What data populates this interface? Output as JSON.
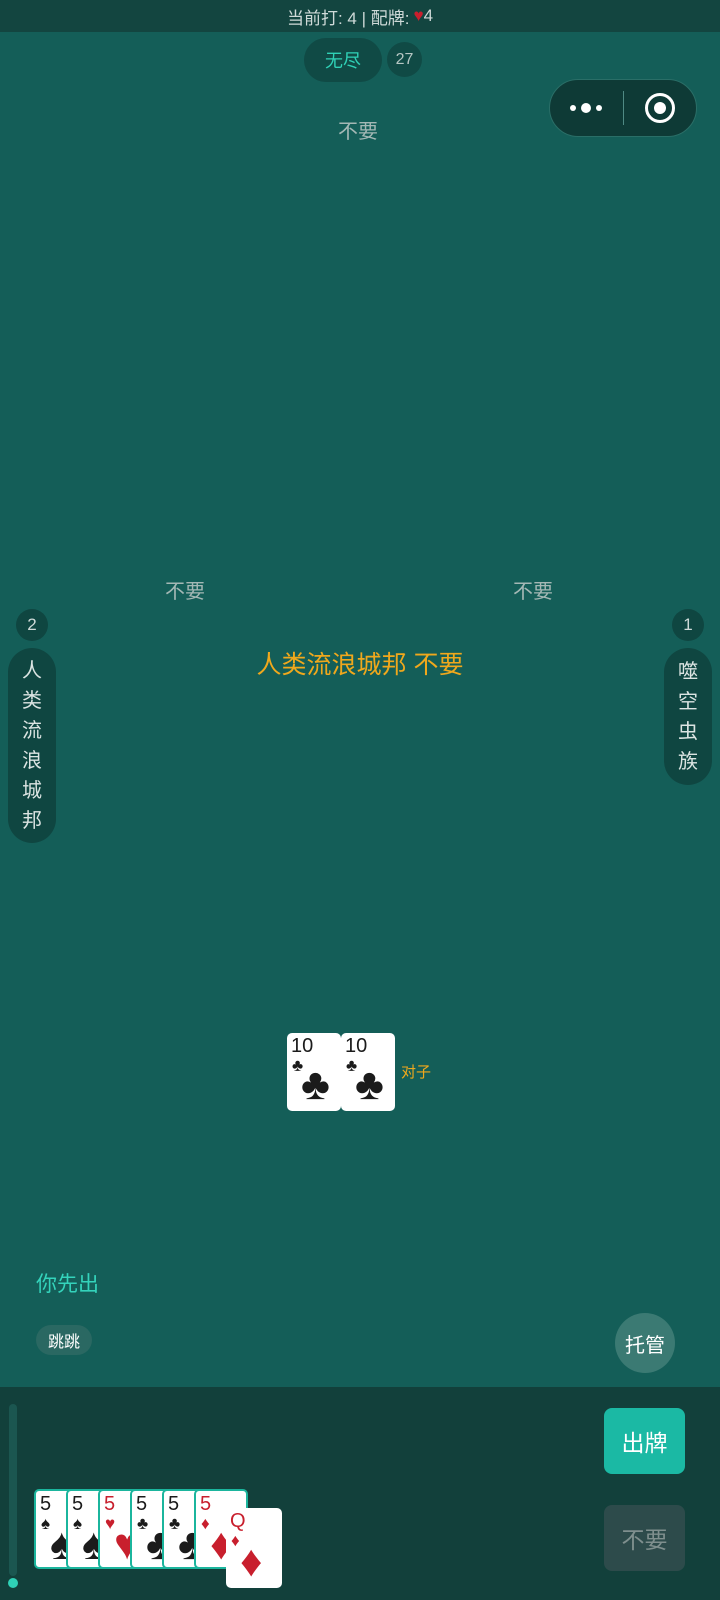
{
  "status_bar": {
    "prefix": "当前打: 4 | 配牌: ",
    "heart": "♥",
    "wild_rank": "4"
  },
  "mode": {
    "label": "无尽",
    "count": "27"
  },
  "capsule": {
    "more_icon": "more-dots-icon",
    "close_icon": "target-icon"
  },
  "opponents": {
    "top": {
      "action": "不要"
    },
    "left": {
      "rank": "2",
      "name_chars": [
        "人",
        "类",
        "流",
        "浪",
        "城",
        "邦"
      ],
      "action": "不要"
    },
    "right": {
      "rank": "1",
      "name_chars": [
        "噬",
        "空",
        "虫",
        "族"
      ],
      "action": "不要"
    }
  },
  "center_message": "人类流浪城邦 不要",
  "last_play": {
    "cards": [
      {
        "rank": "10",
        "suit": "♣",
        "color": "black"
      },
      {
        "rank": "10",
        "suit": "♣",
        "color": "black"
      }
    ],
    "combo": "对子"
  },
  "player": {
    "status": "你先出",
    "nickname": "跳跳"
  },
  "buttons": {
    "auto": "托管",
    "play": "出牌",
    "pass": "不要"
  },
  "hand": [
    {
      "rank": "5",
      "suit": "♠",
      "color": "black"
    },
    {
      "rank": "5",
      "suit": "♠",
      "color": "black"
    },
    {
      "rank": "5",
      "suit": "♥",
      "color": "red"
    },
    {
      "rank": "5",
      "suit": "♣",
      "color": "black"
    },
    {
      "rank": "5",
      "suit": "♣",
      "color": "black"
    },
    {
      "rank": "5",
      "suit": "♦",
      "color": "red"
    },
    {
      "rank": "Q",
      "suit": "♦",
      "color": "red"
    }
  ],
  "colors": {
    "accent": "#2fd1b6",
    "table": "#145e58",
    "highlight": "#f0a81c",
    "heart": "#c81f2d"
  }
}
